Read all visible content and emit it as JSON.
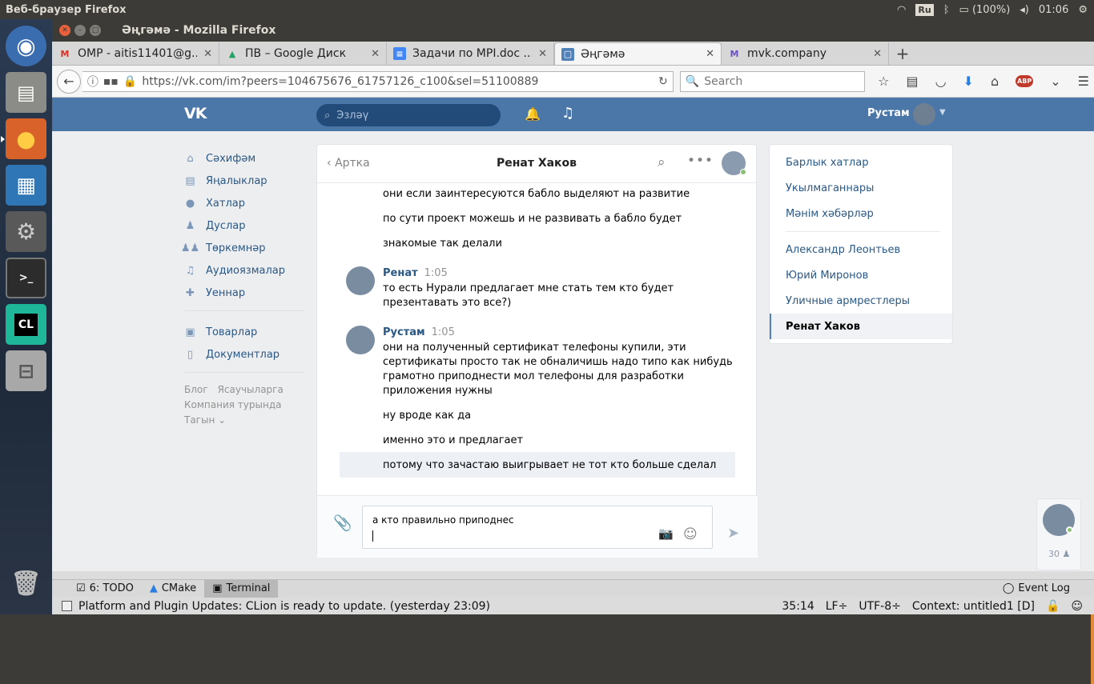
{
  "topbar": {
    "app_name": "Веб-браузер Firefox",
    "keyboard": "Ru",
    "battery": "(100%)",
    "clock": "01:06"
  },
  "launcher": {
    "items": [
      "Ubuntu",
      "Files",
      "Firefox",
      "Writer",
      "Settings",
      "Terminal",
      "CLion",
      "Disk",
      "Trash"
    ],
    "clion_label": "CL",
    "terminal_label": ">_"
  },
  "firefox": {
    "window_title": "Әңгәмә - Mozilla Firefox",
    "tabs": [
      {
        "label": "OMP - aitis11401@g...",
        "icon": "M"
      },
      {
        "label": "ПВ – Google Диск",
        "icon": "▲"
      },
      {
        "label": "Задачи по MPI.doc ...",
        "icon": "≡"
      },
      {
        "label": "Әңгәмә",
        "icon": "▢"
      },
      {
        "label": "mvk.company",
        "icon": "M"
      }
    ],
    "url": "https://vk.com/im?peers=104675676_61757126_c100&sel=51100889",
    "search_placeholder": "Search"
  },
  "vk": {
    "logo": "VK",
    "search_placeholder": "Эзләү",
    "user_name": "Рустам",
    "left_menu": [
      "Сәхифәм",
      "Яңалыклар",
      "Хатлар",
      "Дуслар",
      "Төркемнәр",
      "Аудиоязмалар",
      "Уеннар"
    ],
    "left_menu2": [
      "Товарлар",
      "Документлар"
    ],
    "footer": [
      "Блог",
      "Ясаучыларга",
      "Компания турында",
      "Тагын ⌄"
    ],
    "chat": {
      "back_label": "Артка",
      "peer_name": "Ренат Хаков",
      "messages": {
        "m1": "они если заинтересуются бабло выделяют на развитие",
        "m2": "по сути проект можешь и не развивать а бабло будет",
        "m3": "знакомые так делали",
        "a1_name": "Ренат",
        "a1_time": "1:05",
        "m4a": "то есть Нурали предлагает мне стать тем кто будет",
        "m4b": "презентавать это все?)",
        "a2_name": "Рустам",
        "a2_time": "1:05",
        "m5a": "они на полученный сертификат телефоны купили, эти",
        "m5b": "сертификаты просто так не обналичишь надо типо как нибудь",
        "m5c": "грамотно приподнести мол телефоны для разработки",
        "m5d": "приложения нужны",
        "m6": "ну вроде как да",
        "m7": "именно это и предлагает",
        "m8": "потому что зачастаю выигрывает не тот кто больше сделал"
      },
      "draft": "а кто правильно приподнес"
    },
    "right_menu": [
      "Барлык хатлар",
      "Укылмаганнары",
      "Мәнім хәбәрләр"
    ],
    "right_dialogs": [
      "Александр Леонтьев",
      "Юрий Миронов",
      "Уличные армрестлеры",
      "Ренат Хаков"
    ],
    "fastchat_count": "30"
  },
  "ide": {
    "tools": [
      "6: TODO",
      "CMake",
      "Terminal"
    ],
    "event_log": "Event Log",
    "status": "Platform and Plugin Updates: CLion is ready to update. (yesterday 23:09)",
    "pos": "35:14",
    "lf": "LF÷",
    "enc": "UTF-8÷",
    "context": "Context: untitled1 [D]"
  }
}
